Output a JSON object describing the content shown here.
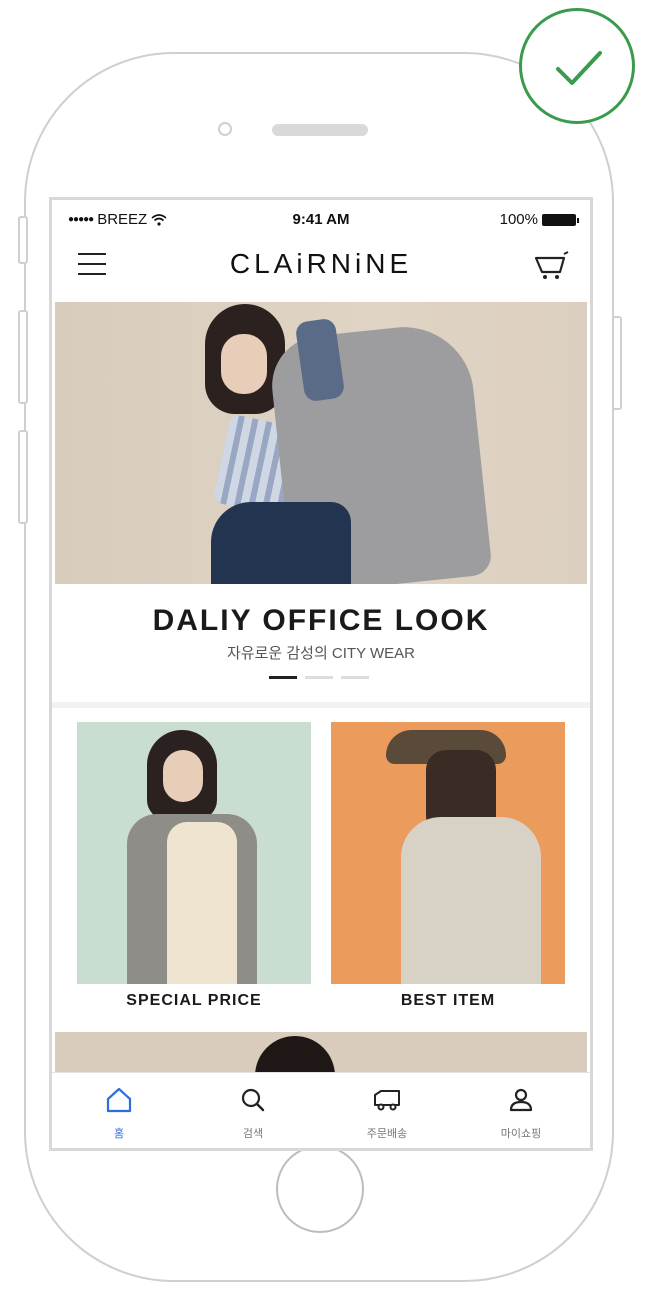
{
  "status_bar": {
    "carrier": "BREEZ",
    "time": "9:41 AM",
    "battery": "100%"
  },
  "header": {
    "logo": "CLAiRNiNE"
  },
  "hero": {
    "title": "DALIY OFFICE LOOK",
    "subtitle": "자유로운 감성의 CITY WEAR",
    "slides_total": 3,
    "active_slide": 1
  },
  "tiles": [
    {
      "label": "SPECIAL PRICE"
    },
    {
      "label": "BEST ITEM"
    }
  ],
  "tabbar": {
    "items": [
      {
        "label": "홈",
        "icon": "home-icon",
        "active": true
      },
      {
        "label": "검색",
        "icon": "search-icon",
        "active": false
      },
      {
        "label": "주문배송",
        "icon": "delivery-truck-icon",
        "active": false
      },
      {
        "label": "마이쇼핑",
        "icon": "user-icon",
        "active": false
      }
    ]
  },
  "colors": {
    "accent": "#2a6ee0",
    "check": "#3a9b4c",
    "tile_left_bg": "#c9ddd0",
    "tile_right_bg": "#eb9c5c",
    "hero_bg": "#dccfbf"
  }
}
